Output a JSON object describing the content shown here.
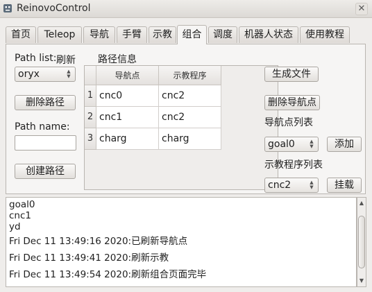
{
  "window": {
    "title": "ReinovoControl",
    "close_label": "✕"
  },
  "tabs": [
    {
      "label": "首页"
    },
    {
      "label": "Teleop"
    },
    {
      "label": "导航"
    },
    {
      "label": "手臂"
    },
    {
      "label": "示教"
    },
    {
      "label": "组合"
    },
    {
      "label": "调度"
    },
    {
      "label": "机器人状态"
    },
    {
      "label": "使用教程"
    }
  ],
  "active_tab": "组合",
  "path_panel": {
    "path_list_label": "Path list:",
    "refresh_label": "刷新",
    "path_select_value": "oryx",
    "delete_path_button": "删除路径",
    "path_name_label": "Path name:",
    "path_name_value": "",
    "create_path_button": "创建路径"
  },
  "route_info": {
    "title": "路径信息",
    "columns": [
      "导航点",
      "示教程序"
    ],
    "rows": [
      {
        "num": "1",
        "waypoint": "cnc0",
        "program": "cnc2"
      },
      {
        "num": "2",
        "waypoint": "cnc1",
        "program": "cnc2"
      },
      {
        "num": "3",
        "waypoint": "charg",
        "program": "charg"
      }
    ]
  },
  "right_panel": {
    "generate_file_button": "生成文件",
    "delete_waypoint_button": "删除导航点",
    "waypoint_list_label": "导航点列表",
    "waypoint_select_value": "goal0",
    "add_button": "添加",
    "program_list_label": "示教程序列表",
    "program_select_value": "cnc2",
    "mount_button": "挂载"
  },
  "log": {
    "lines": [
      "goal0",
      "cnc1",
      "yd"
    ],
    "timestamped": [
      "Fri Dec 11 13:49:16 2020:已刷新导航点",
      "Fri Dec 11 13:49:41 2020:刷新示教",
      "Fri Dec 11 13:49:54 2020:刷新组合页面完毕"
    ]
  },
  "icons": {
    "app": "robot-app-icon",
    "close": "close-icon",
    "dropdown": "spin-arrows-icon",
    "scroll_up": "scroll-up-icon",
    "scroll_down": "scroll-down-icon"
  }
}
